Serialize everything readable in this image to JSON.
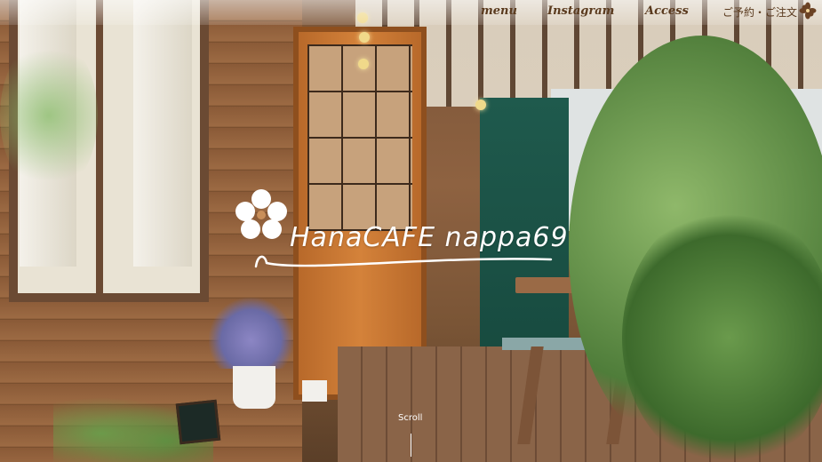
{
  "nav": {
    "menu_label": "menu",
    "instagram_label": "Instagram",
    "access_label": "Access",
    "reserve_label": "ご予約・ご注文",
    "reserve_icon": "flower-icon"
  },
  "hero": {
    "logo_text": "HanaCAFE nappa69",
    "logo_icon": "flower-logo-icon",
    "scroll_label": "Scroll"
  },
  "colors": {
    "nav_text": "#5a3a1e",
    "logo_text": "#ffffff",
    "scroll_text": "#ffffff"
  }
}
